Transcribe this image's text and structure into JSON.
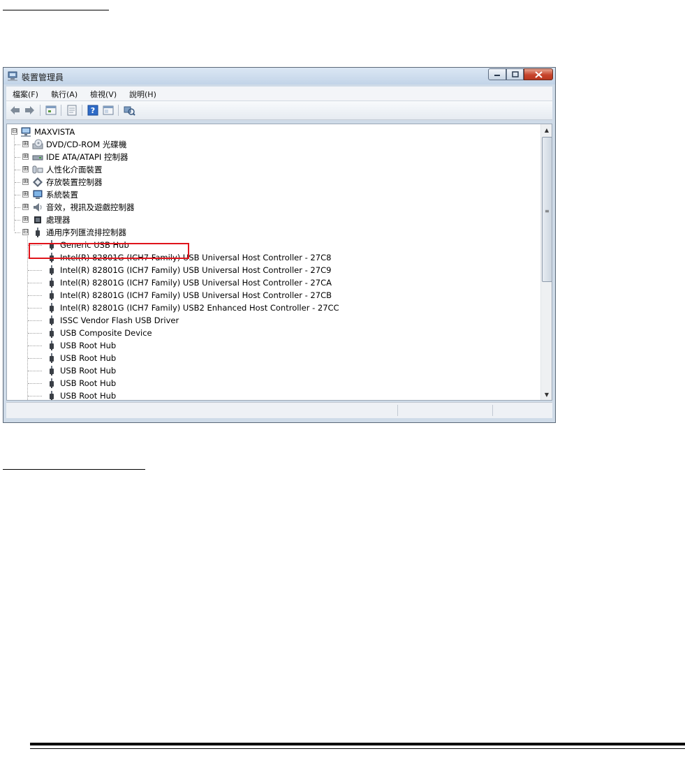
{
  "window": {
    "title": "裝置管理員",
    "icon": "device-manager-icon",
    "controls": [
      "minimize-icon",
      "maximize-icon",
      "close-icon"
    ]
  },
  "menu": {
    "items": [
      {
        "label": "檔案(F)"
      },
      {
        "label": "執行(A)"
      },
      {
        "label": "檢視(V)"
      },
      {
        "label": "說明(H)"
      }
    ]
  },
  "toolbar": {
    "buttons": [
      "back-icon",
      "forward-icon",
      "properties-icon",
      "print-icon",
      "help-icon",
      "show-hide-icon",
      "scan-hardware-icon"
    ]
  },
  "tree": {
    "root": {
      "label": "MAXVISTA",
      "icon": "computer-icon"
    },
    "categories": [
      {
        "label": "DVD/CD-ROM 光碟機",
        "icon": "dvd-drive-icon",
        "state": "collapsed"
      },
      {
        "label": "IDE ATA/ATAPI 控制器",
        "icon": "ide-controller-icon",
        "state": "collapsed"
      },
      {
        "label": "人性化介面裝置",
        "icon": "hid-icon",
        "state": "collapsed"
      },
      {
        "label": "存放裝置控制器",
        "icon": "storage-controller-icon",
        "state": "collapsed"
      },
      {
        "label": "系統裝置",
        "icon": "system-device-icon",
        "state": "collapsed"
      },
      {
        "label": "音效，視訊及遊戲控制器",
        "icon": "sound-icon",
        "state": "collapsed"
      },
      {
        "label": "處理器",
        "icon": "processor-icon",
        "state": "collapsed"
      },
      {
        "label": "通用序列匯流排控制器",
        "icon": "usb-icon",
        "state": "expanded"
      }
    ],
    "usb_children": [
      {
        "label": "Generic USB Hub"
      },
      {
        "label": "Intel(R) 82801G (ICH7 Family) USB Universal Host Controller - 27C8"
      },
      {
        "label": "Intel(R) 82801G (ICH7 Family) USB Universal Host Controller - 27C9"
      },
      {
        "label": "Intel(R) 82801G (ICH7 Family) USB Universal Host Controller - 27CA"
      },
      {
        "label": "Intel(R) 82801G (ICH7 Family) USB Universal Host Controller - 27CB"
      },
      {
        "label": "Intel(R) 82801G (ICH7 Family) USB2 Enhanced Host Controller - 27CC"
      },
      {
        "label": "ISSC Vendor Flash USB Driver",
        "highlighted": true
      },
      {
        "label": "USB Composite Device"
      },
      {
        "label": "USB Root Hub"
      },
      {
        "label": "USB Root Hub"
      },
      {
        "label": "USB Root Hub"
      },
      {
        "label": "USB Root Hub"
      },
      {
        "label": "USB Root Hub"
      }
    ],
    "expander_collapsed": "⊞",
    "expander_expanded": "⊟"
  },
  "colors": {
    "highlight": "#e0141b",
    "frame": "#cfdbe8"
  }
}
